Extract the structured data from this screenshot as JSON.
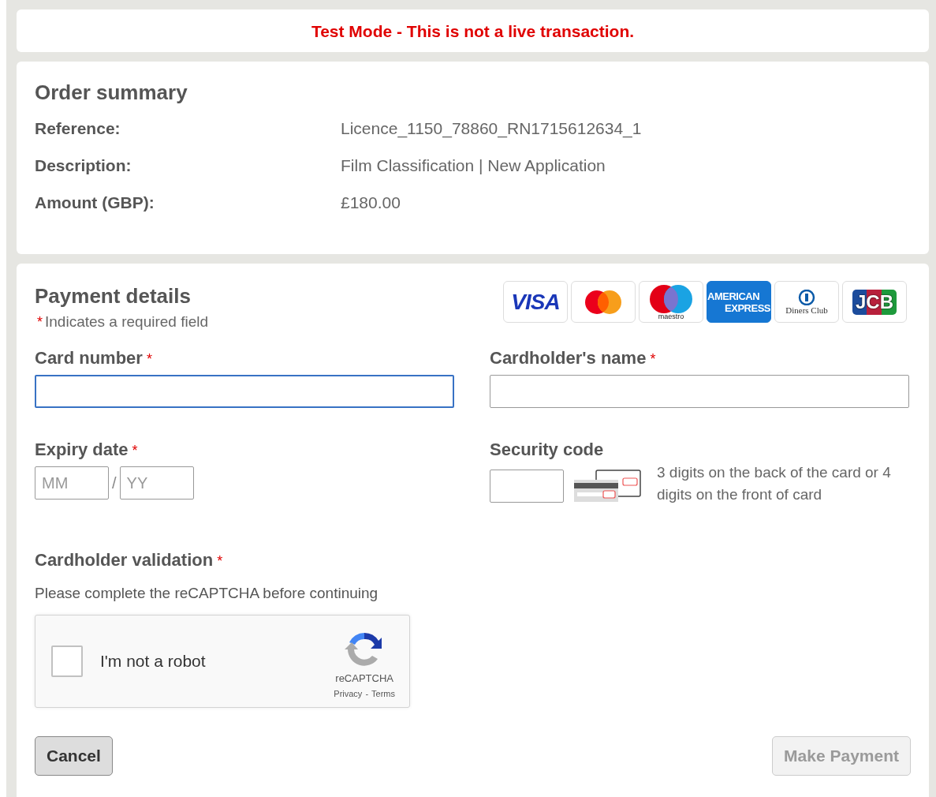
{
  "banner": {
    "text": "Test Mode - This is not a live transaction."
  },
  "order_summary": {
    "title": "Order summary",
    "rows": [
      {
        "label": "Reference:",
        "value": "Licence_1150_78860_RN1715612634_1"
      },
      {
        "label": "Description:",
        "value": "Film Classification | New Application"
      },
      {
        "label": "Amount (GBP):",
        "value": "£180.00"
      }
    ]
  },
  "payment": {
    "title": "Payment details",
    "required_mark": "*",
    "required_note": "Indicates a required field",
    "card_logos": [
      {
        "kind": "visa",
        "lines": [
          "VISA"
        ]
      },
      {
        "kind": "mastercard"
      },
      {
        "kind": "maestro",
        "lines": [
          "maestro"
        ]
      },
      {
        "kind": "amex",
        "lines": [
          "AMERICAN",
          "EXPRESS"
        ]
      },
      {
        "kind": "diners",
        "lines": [
          "Diners Club"
        ]
      },
      {
        "kind": "jcb",
        "lines": [
          "JCB"
        ]
      }
    ],
    "card_number": {
      "label": "Card number",
      "required": true,
      "focused": true
    },
    "cardholder_name": {
      "label": "Cardholder's name",
      "required": true,
      "focused": false
    },
    "expiry": {
      "label": "Expiry date",
      "required": true,
      "month_placeholder": "MM",
      "separator": "/",
      "year_placeholder": "YY"
    },
    "security_code": {
      "label": "Security code",
      "required": false,
      "hint": "3 digits on the back of the card or 4 digits on the front of card"
    },
    "validation": {
      "label": "Cardholder validation",
      "required": true,
      "instruction": "Please complete the reCAPTCHA before continuing",
      "captcha": {
        "checked": false,
        "label": "I'm not a robot",
        "brand": "reCAPTCHA",
        "privacy": "Privacy",
        "separator": "-",
        "terms": "Terms"
      }
    },
    "buttons": [
      {
        "label": "Cancel",
        "disabled": false
      },
      {
        "label": "Make Payment",
        "disabled": true
      }
    ]
  }
}
